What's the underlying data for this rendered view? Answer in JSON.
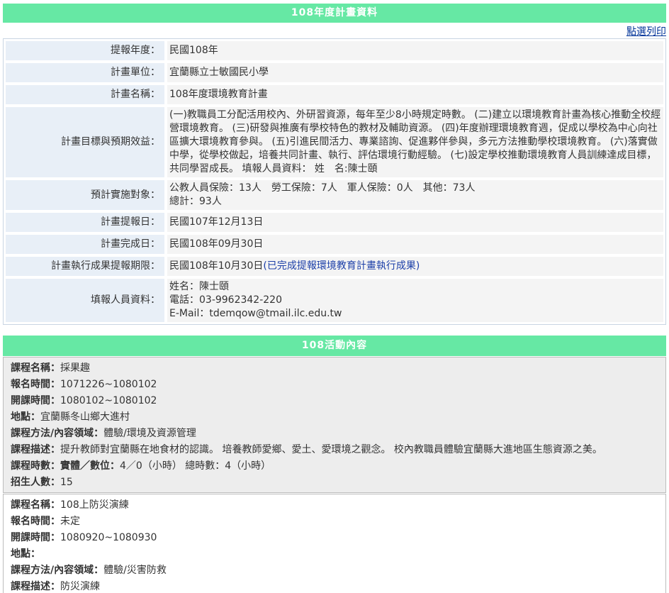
{
  "header": {
    "title": "108年度計畫資料",
    "print_link": "點選列印"
  },
  "info": {
    "rows": [
      {
        "label": "提報年度：",
        "value": "民國108年"
      },
      {
        "label": "計畫單位：",
        "value": "宜蘭縣立士敏國民小學"
      },
      {
        "label": "計畫名稱：",
        "value": "108年度環境教育計畫"
      }
    ],
    "goals_label": "計畫目標與預期效益：",
    "goals_text": "(一)教職員工分配活用校內、外研習資源，每年至少8小時規定時數。 (二)建立以環境教育計畫為核心推動全校經營環境教育。 (三)研發與推廣有學校特色的教材及輔助資源。 (四)年度辦理環境教育週，促成以學校為中心向社區擴大環境教育參與。 (五)引進民間活力、專業諮詢、促進夥伴參與，多元方法推動學校環境教育。 (六)落實做中學，從學校做起，培養共同計畫、執行、評估環境行動經驗。 (七)設定學校推動環境教育人員訓練達成目標，共同學習成長。 填報人員資料： 姓　名:陳士頤",
    "target_label": "預計實施對象：",
    "target_line1": "公教人員保險：13人　勞工保險：7人　軍人保險：0人　其他：73人",
    "target_line2": "總計：93人",
    "report_date_label": "計畫提報日：",
    "report_date": "民國107年12月13日",
    "complete_date_label": "計畫完成日：",
    "complete_date": "民國108年09月30日",
    "deadline_label": "計畫執行成果提報期限：",
    "deadline_date": "民國108年10月30日",
    "deadline_link": "(已完成提報環境教育計畫執行成果)",
    "contact_label": "填報人員資料：",
    "contact_name": "姓名：陳士頤",
    "contact_phone": "電話：03-9962342-220",
    "contact_email": "E-Mail：tdemqow@tmail.ilc.edu.tw"
  },
  "activities_header": "108活動內容",
  "activities": [
    {
      "lines": [
        {
          "label": "課程名稱：",
          "value": "採果趣"
        },
        {
          "label": "報名時間：",
          "value": "1071226~1080102"
        },
        {
          "label": "開課時間：",
          "value": "1080102~1080102"
        },
        {
          "label": "地點：",
          "value": "宜蘭縣冬山鄉大進村"
        },
        {
          "label": "課程方法/內容領域：",
          "value": "體驗/環境及資源管理"
        },
        {
          "label": "課程描述：",
          "value": "提升教師對宜蘭縣在地食材的認識。 培養教師愛鄉、愛土、愛環境之觀念。 校內教職員體驗宜蘭縣大進地區生態資源之美。"
        },
        {
          "label": "課程時數：實體／數位：",
          "value": "4／0（小時）  總時數：4（小時）"
        },
        {
          "label": "招生人數：",
          "value": "15"
        }
      ]
    },
    {
      "lines": [
        {
          "label": "課程名稱：",
          "value": "108上防災演練"
        },
        {
          "label": "報名時間：",
          "value": "未定"
        },
        {
          "label": "開課時間：",
          "value": "1080920~1080930"
        },
        {
          "label": "地點：",
          "value": ""
        },
        {
          "label": "課程方法/內容領域：",
          "value": "體驗/災害防救"
        },
        {
          "label": "課程描述：",
          "value": "防災演練"
        }
      ]
    }
  ]
}
